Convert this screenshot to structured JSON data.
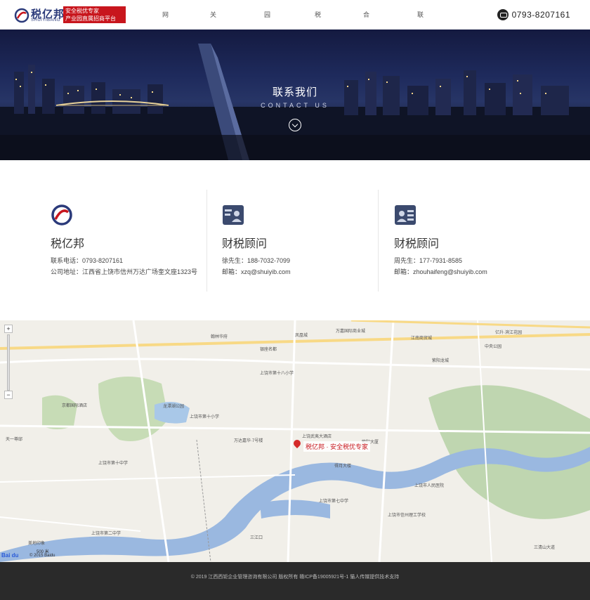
{
  "header": {
    "logo_cn": "税亿邦",
    "logo_en": "SHUIYIBANG",
    "tagline_1": "安全税优专家",
    "tagline_2": "产业园直属招商平台",
    "nav": [
      "网站首页",
      "关于税亿邦",
      "园区风采",
      "税优案例",
      "合伙人招募",
      "联系我们"
    ],
    "phone": "0793-8207161"
  },
  "banner": {
    "title": "联系我们",
    "subtitle": "CONTACT US"
  },
  "cards": [
    {
      "name": "税亿邦",
      "line1": "联系电话：0793-8207161",
      "line2": "公司地址：江西省上饶市信州万达广场奎文座1323号",
      "icon": "company-logo-icon"
    },
    {
      "name": "财税顾问",
      "line1": "徐先生：188-7032-7099",
      "line2": "邮箱：xzq@shuiyib.com",
      "icon": "person-card-icon"
    },
    {
      "name": "财税顾问",
      "line1": "周先生：177-7931-8585",
      "line2": "邮箱：zhouhaifeng@shuiyib.com",
      "icon": "id-card-icon"
    }
  ],
  "map": {
    "pin_label": "税亿邦 · 安全税优专家",
    "labels": [
      "翰林华府",
      "银座名都",
      "凤凰城",
      "万嘉国际商业城",
      "江南商贸城",
      "亿升·滨江花园",
      "中央公园",
      "紫阳龙城",
      "上饶市第十八小学",
      "龙潭湖公园",
      "万达嘉华·7号楼",
      "上饶武夷大酒店",
      "紫阳大厦",
      "得月大楼",
      "上饶市人民医院",
      "上饶市第七中学",
      "上饶市信州理工学校",
      "三江口",
      "上饶市第二中学",
      "美地印象",
      "天一尊邸",
      "京都国际酒店",
      "上饶市第十小学",
      "上饶市第十中学",
      "三清山大道"
    ],
    "copyright": "© 2015 Baidu",
    "scale": "500 米",
    "brand": "Bai du"
  },
  "footer": {
    "text": "© 2019 江西西钜企业管理咨询有限公司 版权所有 赣ICP备19005921号-1 猫人传媒提供技术支持"
  }
}
